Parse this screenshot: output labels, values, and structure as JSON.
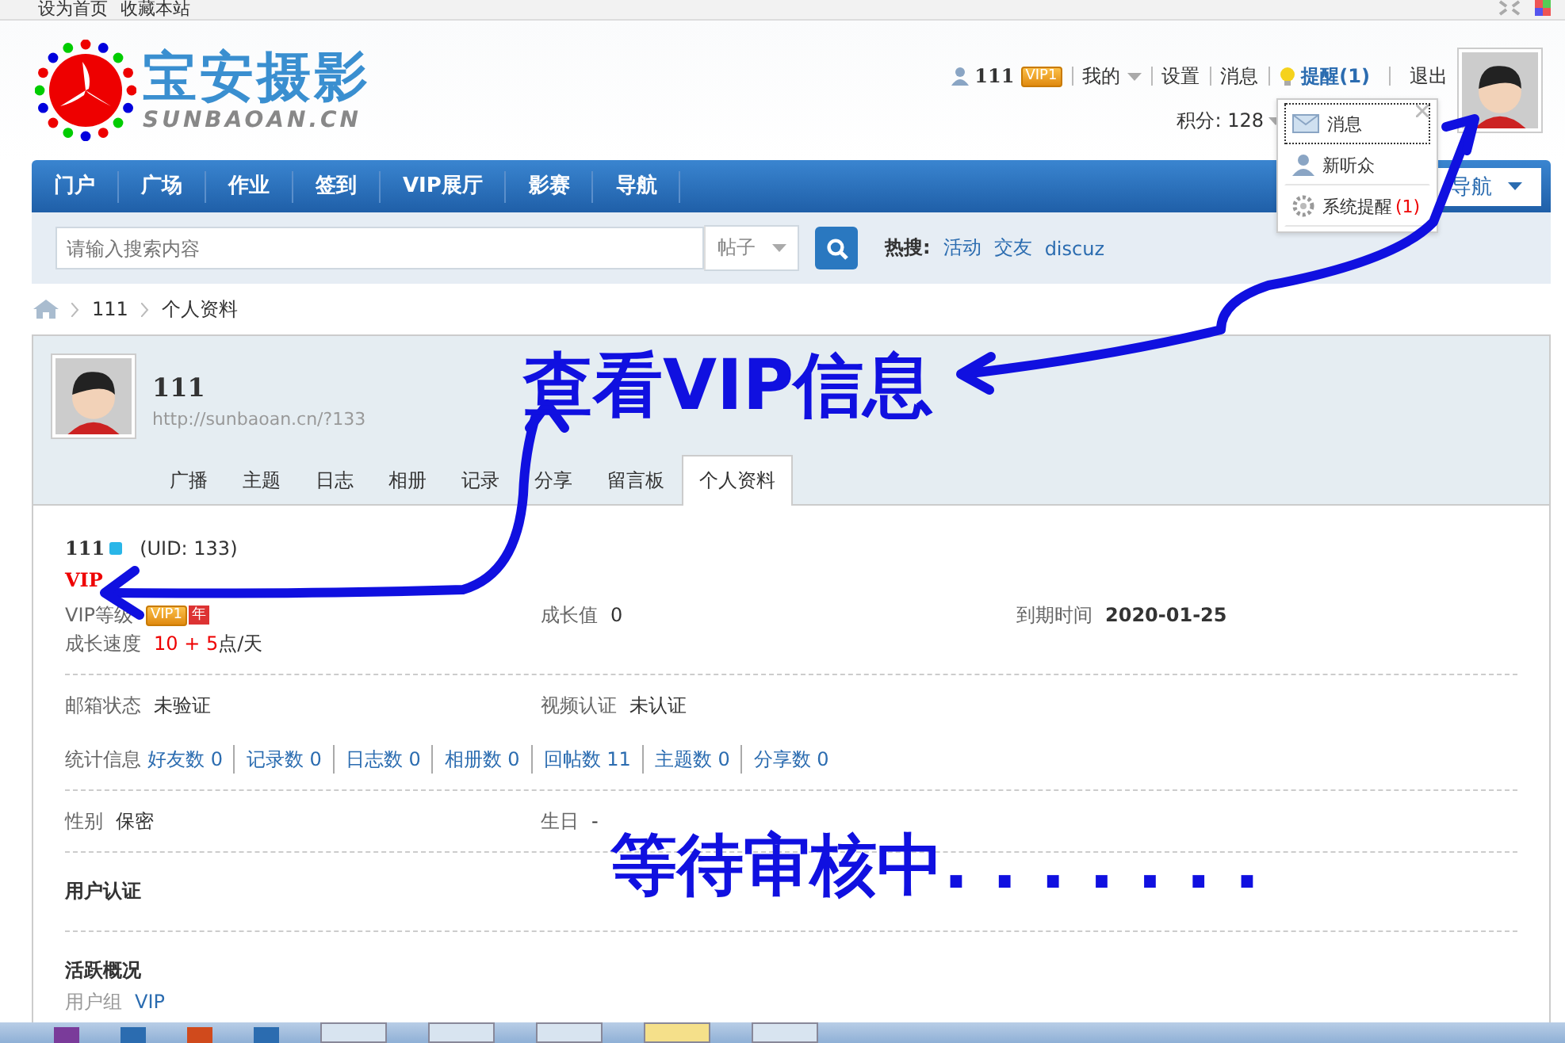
{
  "top_bar": {
    "links": [
      "设为首页",
      "收藏本站"
    ]
  },
  "header": {
    "logo_text": "宝安摄影",
    "logo_sub": "SUNBAOAN.CN",
    "user": {
      "name": "111",
      "vip_badge": "VIP1"
    },
    "menu_link": "我的",
    "links": [
      "设置",
      "消息"
    ],
    "notice": "提醒(1)",
    "logout": "退出",
    "points": "积分: 128"
  },
  "notice_menu": {
    "items": [
      {
        "kind": "mail",
        "label": "消息",
        "selected": true
      },
      {
        "kind": "person",
        "label": "新听众",
        "selected": false
      },
      {
        "kind": "gear",
        "label": "系统提醒",
        "count": "(1)",
        "selected": false
      }
    ]
  },
  "nav": {
    "items": [
      "门户",
      "广场",
      "作业",
      "签到",
      "VIP展厅",
      "影赛",
      "导航"
    ],
    "quick": "导航"
  },
  "search": {
    "placeholder": "请输入搜索内容",
    "scope": "帖子",
    "hot_label": "热搜:",
    "hot": [
      "活动",
      "交友",
      "discuz"
    ]
  },
  "breadcrumb": [
    "111",
    "个人资料"
  ],
  "profile": {
    "name": "111",
    "url": "http://sunbaoan.cn/?133",
    "tabs": [
      {
        "label": "广播",
        "selected": false
      },
      {
        "label": "主题",
        "selected": false
      },
      {
        "label": "日志",
        "selected": false
      },
      {
        "label": "相册",
        "selected": false
      },
      {
        "label": "记录",
        "selected": false
      },
      {
        "label": "分享",
        "selected": false
      },
      {
        "label": "留言板",
        "selected": false
      },
      {
        "label": "个人资料",
        "selected": true
      }
    ],
    "display_name": "111",
    "uid": "(UID: 133)",
    "group_tag": "VIP",
    "vip_level": {
      "label": "VIP等级",
      "badge": "VIP1",
      "year_badge": "年"
    },
    "growth": {
      "label": "成长值",
      "value": "0"
    },
    "expiry": {
      "label": "到期时间",
      "value": "2020-01-25"
    },
    "speed": {
      "label": "成长速度",
      "value": "10 + 5",
      "unit": "点/天"
    },
    "email": {
      "label": "邮箱状态",
      "value": "未验证"
    },
    "video": {
      "label": "视频认证",
      "value": "未认证"
    },
    "stats_label": "统计信息",
    "stats": [
      "好友数 0",
      "记录数 0",
      "日志数 0",
      "相册数 0",
      "回帖数 11",
      "主题数 0",
      "分享数 0"
    ],
    "gender": {
      "label": "性别",
      "value": "保密"
    },
    "birthday": {
      "label": "生日",
      "value": "-"
    },
    "sections": [
      "用户认证",
      "活跃概况"
    ],
    "user_group": {
      "label": "用户组",
      "value": "VIP"
    }
  },
  "annotations": [
    "查看VIP信息",
    "等待审核中. . . . . . ."
  ]
}
